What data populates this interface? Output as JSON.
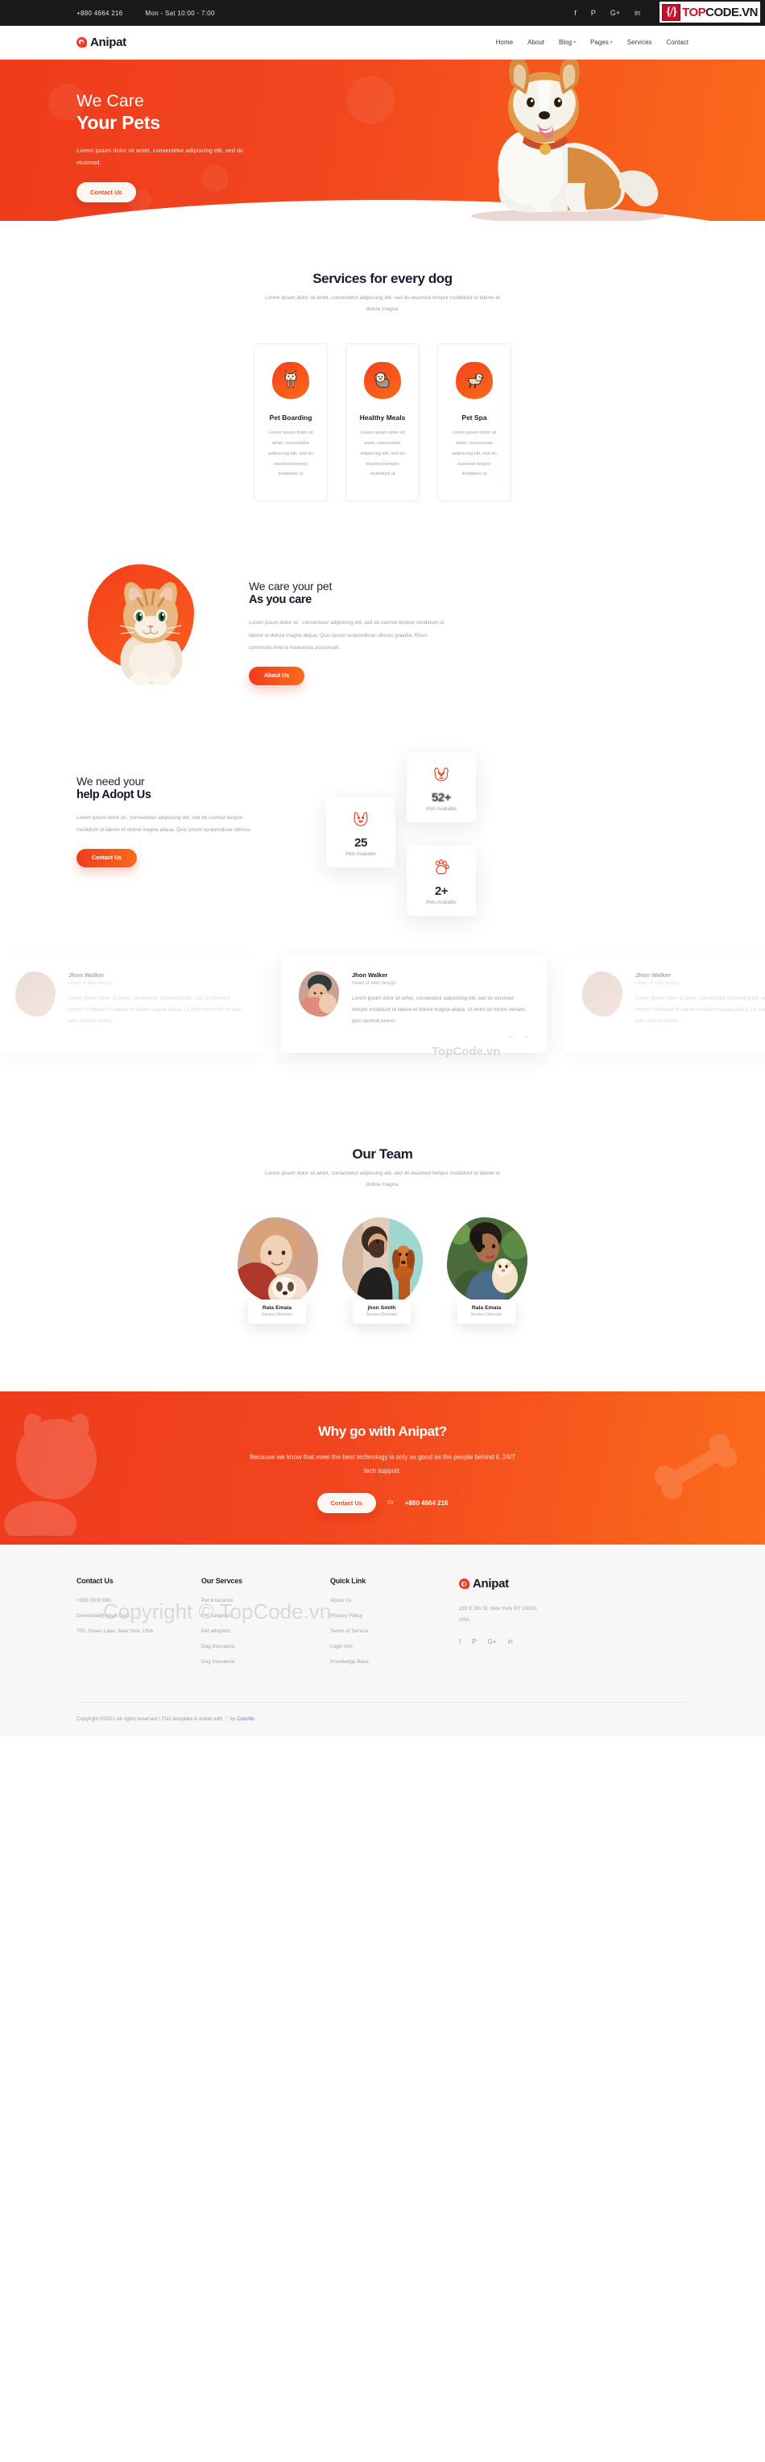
{
  "topbar": {
    "phone": "+880 4664 216",
    "hours": "Mon - Sat 10:00 - 7:00",
    "socials": [
      "f",
      "P",
      "G+",
      "in"
    ]
  },
  "watermark_badge": {
    "mark": "{/}",
    "text_a": "TOP",
    "text_b": "CODE.VN"
  },
  "nav": {
    "brand": "Anipat",
    "links": [
      {
        "label": "Home",
        "caret": false
      },
      {
        "label": "About",
        "caret": false
      },
      {
        "label": "Blog",
        "caret": true
      },
      {
        "label": "Pages",
        "caret": true
      },
      {
        "label": "Services",
        "caret": false
      },
      {
        "label": "Contact",
        "caret": false
      }
    ]
  },
  "hero": {
    "title_light": "We Care",
    "title_bold": "Your Pets",
    "paragraph": "Lorem ipsum dolor sit amet, consectetur adipiscing elit, sed do eiusmod.",
    "cta": "Contact Us"
  },
  "services": {
    "title": "Services for every dog",
    "subtitle": "Lorem ipsum dolor sit amet, consectetur adipiscing elit, sed do eiusmod tempor incididunt ut labore et dolore magna.",
    "cards": [
      {
        "icon": "dog-standing-icon",
        "title": "Pet Boarding",
        "text": "Lorem ipsum dolor sit amet, consectetur adipiscing elit, sed do eiusmod tempor incididunt ut"
      },
      {
        "icon": "dog-sitting-icon",
        "title": "Healthy Meals",
        "text": "Lorem ipsum dolor sit amet, consectetur adipiscing elit, sed do eiusmod tempor incididunt ut"
      },
      {
        "icon": "dog-running-icon",
        "title": "Pet Spa",
        "text": "Lorem ipsum dolor sit amet, consectetur adipiscing elit, sed do eiusmod tempor incididunt ut"
      }
    ]
  },
  "care": {
    "title_light": "We care your pet",
    "title_bold": "As you care",
    "paragraph": "Lorem ipsum dolor sit , consectetur adipiscing elit, sed do iusmod tempor incididunt ut labore et dolore magna aliqua. Quis ipsum suspendisse ultrices gravida. Risus commodo viverra maecenas accumsan.",
    "cta": "About Us"
  },
  "watermarks": {
    "mid": "TopCode.vn",
    "footer": "Copyright © TopCode.vn"
  },
  "adopt": {
    "title_light": "We need your",
    "title_bold": "help Adopt Us",
    "paragraph": "Lorem ipsum dolor sit , consectetur adipiscing elit, sed do iusmod tempor incididunt ut labore et dolore magna aliqua. Quis ipsum suspendisse ultrices.",
    "cta": "Contact Us",
    "stats": [
      {
        "icon": "dog-face-icon",
        "value": "25",
        "label": "Pets Available"
      },
      {
        "icon": "puppy-face-icon",
        "value": "52+",
        "label": "Pets Available"
      },
      {
        "icon": "paw-icon",
        "value": "2+",
        "label": "Pets Available"
      }
    ]
  },
  "testimonials": {
    "items": [
      {
        "name": "Jhon Walker",
        "role": "Head of web design",
        "text": "Lorem ipsum dolor sit amet, consectetur adipisicing elit, sed do eiusmod tempor incididunt ut labore et dolore magna aliqua. Ut enim ad minim veniam, quis nostrud exerci."
      },
      {
        "name": "Jhon Walker",
        "role": "Head of web design",
        "text": "Lorem ipsum dolor sit amet, consectetur adipisicing elit, sed do eiusmod tempor incididunt ut labore et dolore magna aliqua. Ut enim ad minim veniam, quis nostrud exerci."
      },
      {
        "name": "Jhon Walker",
        "role": "Head of web design",
        "text": "Lorem ipsum dolor sit amet, consectetur adipisicing elit, sed do eiusmod tempor incididunt ut labore et dolore magna aliqua. Ut enim ad minim veniam, quis nostrud exerci."
      }
    ],
    "prev": "←",
    "next": "→"
  },
  "team": {
    "title": "Our Team",
    "subtitle": "Lorem ipsum dolor sit amet, consectetur adipiscing elit, sed do eiusmod tempor incididunt ut labore et dolore magna.",
    "members": [
      {
        "name": "Rala Emaia",
        "role": "Senior Director"
      },
      {
        "name": "jhon Smith",
        "role": "Senior Director"
      },
      {
        "name": "Rala Emaia",
        "role": "Senior Director"
      }
    ]
  },
  "cta": {
    "title": "Why go with Anipat?",
    "paragraph": "Because we know that even the best technology is only as good as the people behind it. 24/7 tech support.",
    "button": "Contact Us",
    "or": "Or",
    "phone": "+880 4664 216"
  },
  "footer": {
    "columns": [
      {
        "title": "Contact Us",
        "items": [
          "+555 0000 565",
          "Demomail@gmail.Com",
          "700, Green Lane, New York, USA"
        ]
      },
      {
        "title": "Our Servces",
        "items": [
          "Pet Insurance",
          "Pet surgeries",
          "Pet adoption",
          "Dog Insurance",
          "Dog Insurance"
        ]
      },
      {
        "title": "Quick Link",
        "items": [
          "About Us",
          "Privacy Policy",
          "Terms of Service",
          "Login info",
          "Knowledge Base"
        ]
      }
    ],
    "brand": "Anipat",
    "address": "239 E 5th St, New York NY 10003, USA",
    "socials": [
      "f",
      "P",
      "G+",
      "in"
    ],
    "copyright_prefix": "Copyright ©2021 All rights reserved | This template is made with ",
    "copyright_heart": "♡",
    "copyright_by": " by ",
    "copyright_link": "Colorlib"
  },
  "colors": {
    "brand_orange": "#ef3c1c",
    "brand_orange_light": "#fb6b1b",
    "dark": "#1b1b2f",
    "topbar": "#1c1a19",
    "muted": "#9d9daa"
  }
}
